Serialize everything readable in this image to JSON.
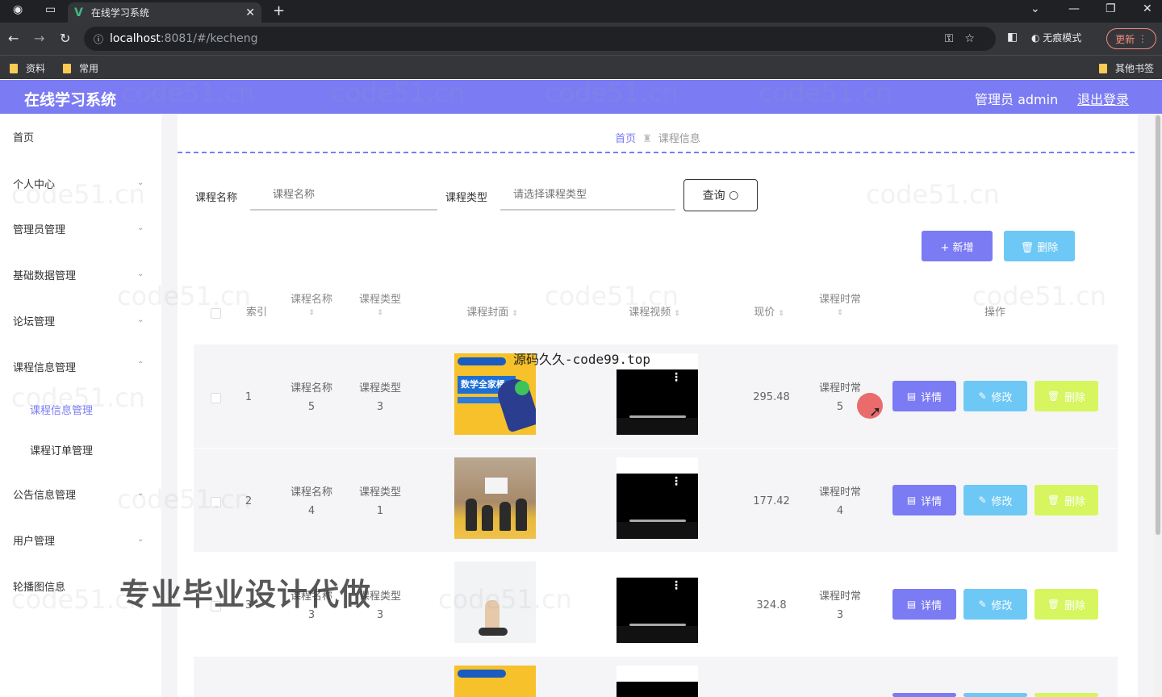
{
  "browser": {
    "tab_title": "在线学习系统",
    "url_host": "localhost",
    "url_path": ":8081/#/kecheng",
    "incognito_label": "无痕模式",
    "update_label": "更新",
    "bookmarks": [
      "资料",
      "常用"
    ],
    "other_bookmarks": "其他书签"
  },
  "header": {
    "title": "在线学习系统",
    "user": "管理员 admin",
    "logout": "退出登录"
  },
  "sidebar": {
    "items": [
      "首页",
      "个人中心",
      "管理员管理",
      "基础数据管理",
      "论坛管理",
      "课程信息管理",
      "课程信息管理",
      "课程订单管理",
      "公告信息管理",
      "用户管理",
      "轮播图信息"
    ]
  },
  "breadcrumb": {
    "home": "首页",
    "current": "课程信息"
  },
  "search": {
    "name_label": "课程名称",
    "name_placeholder": "课程名称",
    "type_label": "课程类型",
    "type_placeholder": "请选择课程类型",
    "query_button": "查询"
  },
  "toolbar": {
    "add_label": "新增",
    "delete_label": "删除"
  },
  "table": {
    "headers": {
      "index": "索引",
      "name": "课程名称",
      "type": "课程类型",
      "cover": "课程封面",
      "video": "课程视频",
      "price": "现价",
      "hours": "课程时常",
      "actions": "操作"
    },
    "rows": [
      {
        "index": "1",
        "name_label": "课程名称",
        "name_value": "5",
        "type_label": "课程类型",
        "type_value": "3",
        "price": "295.48",
        "hours_label": "课程时常",
        "hours_value": "5"
      },
      {
        "index": "2",
        "name_label": "课程名称",
        "name_value": "4",
        "type_label": "课程类型",
        "type_value": "1",
        "price": "177.42",
        "hours_label": "课程时常",
        "hours_value": "4"
      },
      {
        "index": "3",
        "name_label": "课程名称",
        "name_value": "3",
        "type_label": "课程类型",
        "type_value": "3",
        "price": "324.8",
        "hours_label": "课程时常",
        "hours_value": "3"
      }
    ],
    "actions": {
      "detail": "详情",
      "edit": "修改",
      "delete": "删除"
    }
  },
  "cover_text": "数学全家桶",
  "overlays": {
    "source": "源码久久-code99.top",
    "banner": "专业毕业设计代做",
    "watermark": "code51.cn"
  }
}
